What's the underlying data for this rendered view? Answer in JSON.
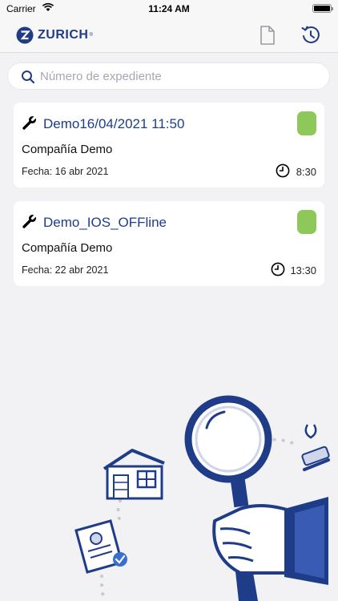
{
  "status_bar": {
    "carrier": "Carrier",
    "time": "11:24 AM"
  },
  "header": {
    "logo_text": "ZURICH",
    "logo_mark": "®",
    "brand_color": "#1f3c88"
  },
  "search": {
    "placeholder": "Número de expediente",
    "value": ""
  },
  "cases": [
    {
      "title": "Demo16/04/2021 11:50",
      "company": "Compañía Demo",
      "date_label": "Fecha: 16 abr 2021",
      "time": "8:30",
      "status_color": "#8fc85a"
    },
    {
      "title": "Demo_IOS_OFFline",
      "company": "Compañía Demo",
      "date_label": "Fecha: 22 abr 2021",
      "time": "13:30",
      "status_color": "#8fc85a"
    }
  ],
  "icons": {
    "document": "document-icon",
    "sync": "sync-history-icon",
    "search": "search-icon",
    "wrench": "wrench-icon",
    "clock": "clock-icon"
  }
}
